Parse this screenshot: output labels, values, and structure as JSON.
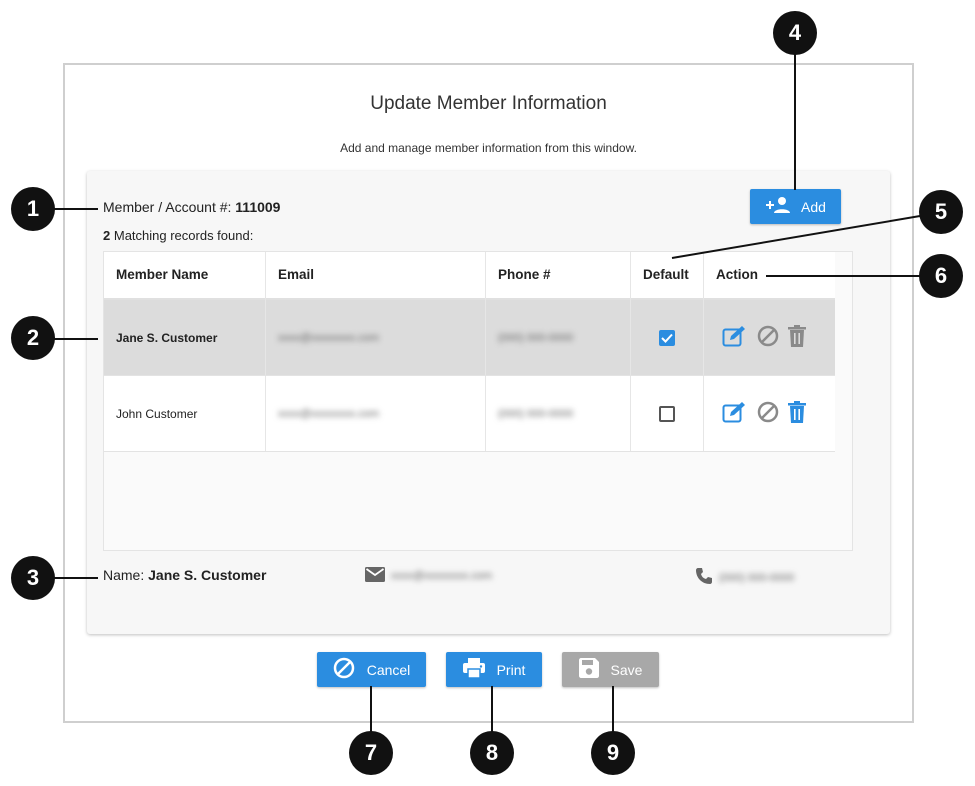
{
  "dialog": {
    "title": "Update Member Information",
    "subtitle": "Add and manage member information from this window."
  },
  "account": {
    "label": "Member / Account #:",
    "number": "111009"
  },
  "matching": {
    "count": "2",
    "text": "Matching records found:"
  },
  "add_button": {
    "label": "Add",
    "icon": "person-add-icon"
  },
  "table": {
    "columns": [
      "Member Name",
      "Email",
      "Phone #",
      "Default",
      "Action"
    ],
    "rows": [
      {
        "name": "Jane S. Customer",
        "email": "xxxx@xxxxxxxx.com",
        "phone": "(000) 000-0000",
        "default": true,
        "selected": true
      },
      {
        "name": "John Customer",
        "email": "xxxx@xxxxxxxx.com",
        "phone": "(000) 000-0000",
        "default": false,
        "selected": false
      }
    ]
  },
  "selected_info": {
    "name_label": "Name:",
    "name": "Jane S. Customer",
    "email": "xxxx@xxxxxxxx.com",
    "phone": "(000) 000-0000"
  },
  "buttons": {
    "cancel": "Cancel",
    "print": "Print",
    "save": "Save"
  },
  "callouts": [
    "1",
    "2",
    "3",
    "4",
    "5",
    "6",
    "7",
    "8",
    "9"
  ],
  "colors": {
    "primary": "#2b8de0",
    "disabled": "#a8a8a8",
    "selected_row": "#dcdcdc",
    "callout": "#111111"
  }
}
